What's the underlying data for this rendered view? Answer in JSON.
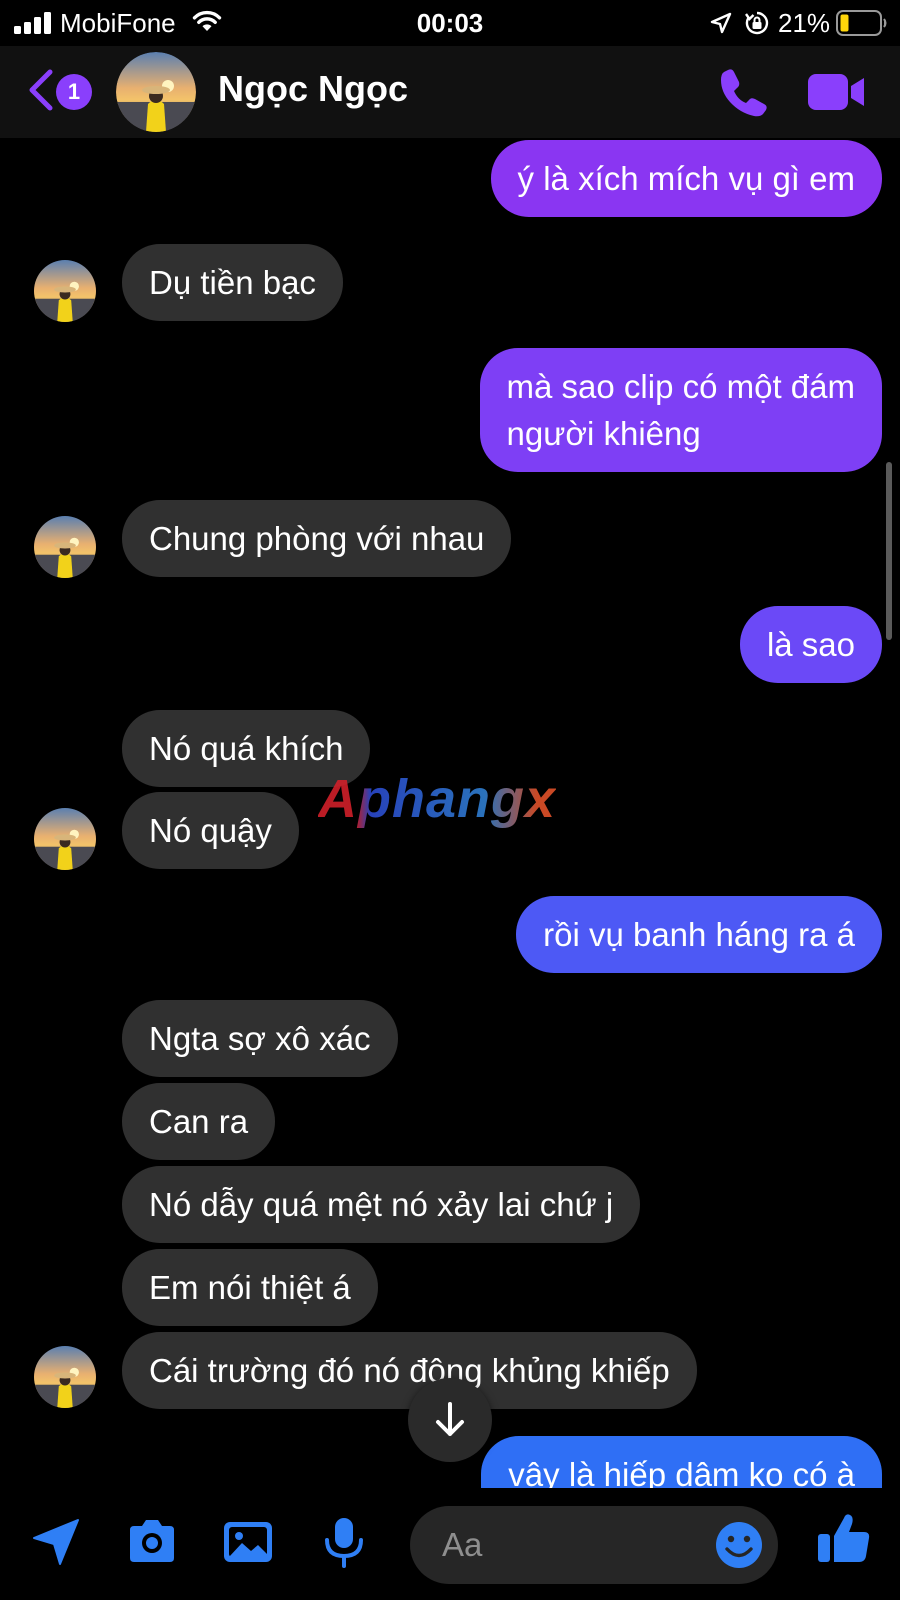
{
  "status_bar": {
    "carrier": "MobiFone",
    "time": "00:03",
    "battery_percent": "21%"
  },
  "header": {
    "back_badge_count": "1",
    "contact_name": "Ngọc Ngọc"
  },
  "messages": [
    {
      "side": "out",
      "lines": [
        "ý là xích mích vụ gì em"
      ],
      "color": "#8a36f2"
    },
    {
      "side": "in",
      "lines": [
        "Dụ tiền bạc"
      ]
    },
    {
      "side": "out",
      "lines": [
        "mà sao clip có một đám",
        "người khiêng"
      ],
      "color": "#7e3ff5"
    },
    {
      "side": "in",
      "lines": [
        "Chung phòng với nhau"
      ]
    },
    {
      "side": "out",
      "lines": [
        "là sao"
      ],
      "color": "#6b49f7"
    },
    {
      "side": "in",
      "lines": [
        "Nó quá khích"
      ]
    },
    {
      "side": "in",
      "lines": [
        "Nó quậy"
      ]
    },
    {
      "side": "out",
      "lines": [
        "rồi vụ banh háng ra á"
      ],
      "color": "#4d59f5"
    },
    {
      "side": "in",
      "lines": [
        "Ngta sợ xô xác"
      ]
    },
    {
      "side": "in",
      "lines": [
        "Can ra"
      ]
    },
    {
      "side": "in",
      "lines": [
        "Nó dẫy quá mệt nó xảy lai chứ j"
      ]
    },
    {
      "side": "in",
      "lines": [
        "Em nói thiệt á"
      ]
    },
    {
      "side": "in",
      "lines": [
        "Cái trường đó nó động khủng khiếp"
      ]
    },
    {
      "side": "out",
      "lines": [
        "vậy là hiếp dâm ko có à"
      ],
      "color": "#2f6ff5"
    }
  ],
  "watermark": "Aphangx",
  "composer": {
    "placeholder": "Aa"
  },
  "colors": {
    "accent": "#8a3ffc",
    "incoming_bubble": "#303030",
    "composer_icon": "#2f7ff5"
  }
}
